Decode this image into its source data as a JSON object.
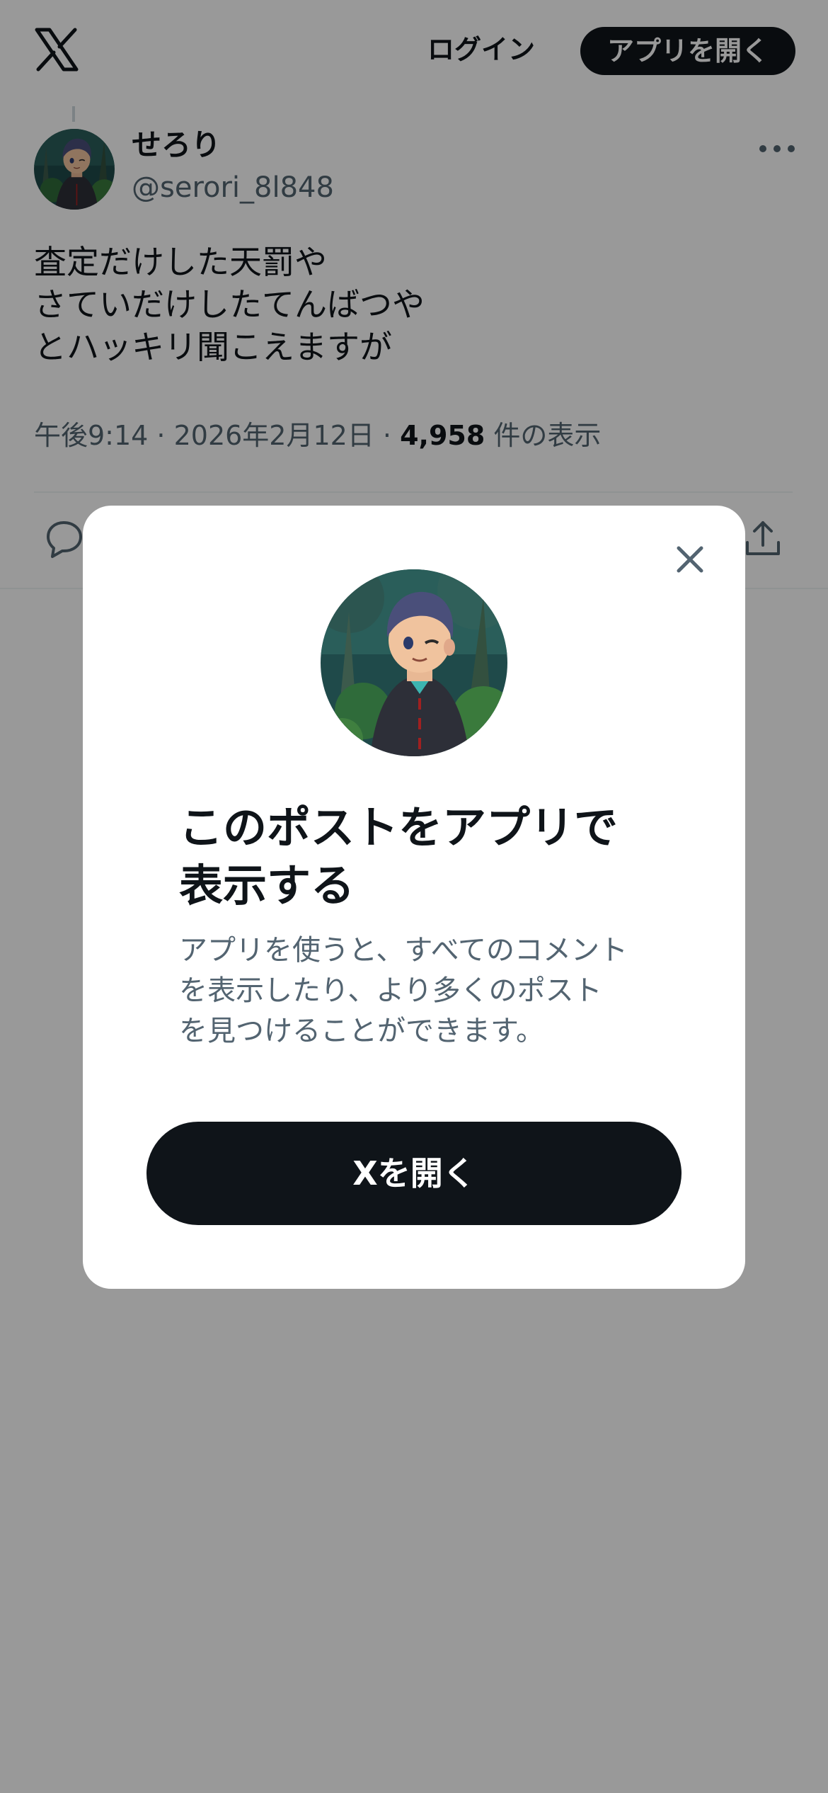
{
  "header": {
    "logo_icon": "x-logo-icon",
    "login_label": "ログイン",
    "open_app_label": "アプリを開く"
  },
  "post": {
    "display_name": "せろり",
    "handle": "@serori_8l848",
    "text_lines": [
      "査定だけした天罰や",
      "さていだけしたてんばつや",
      "とハッキリ聞こえますが"
    ],
    "time": "午後9:14",
    "separator": " · ",
    "date": "2026年2月12日",
    "views_count": "4,958",
    "views_suffix": " 件の表示"
  },
  "modal": {
    "title_lines": [
      "このポストをアプリで",
      "表示する"
    ],
    "description_lines": [
      "アプリを使うと、すべてのコメント",
      "を表示したり、より多くのポスト",
      "を見つけることができます。"
    ],
    "open_button_label": "Xを開く"
  },
  "colors": {
    "text_primary": "#0f1419",
    "text_secondary": "#536471",
    "overlay": "rgba(0,0,0,0.40)",
    "button_dark": "#0f1419"
  }
}
